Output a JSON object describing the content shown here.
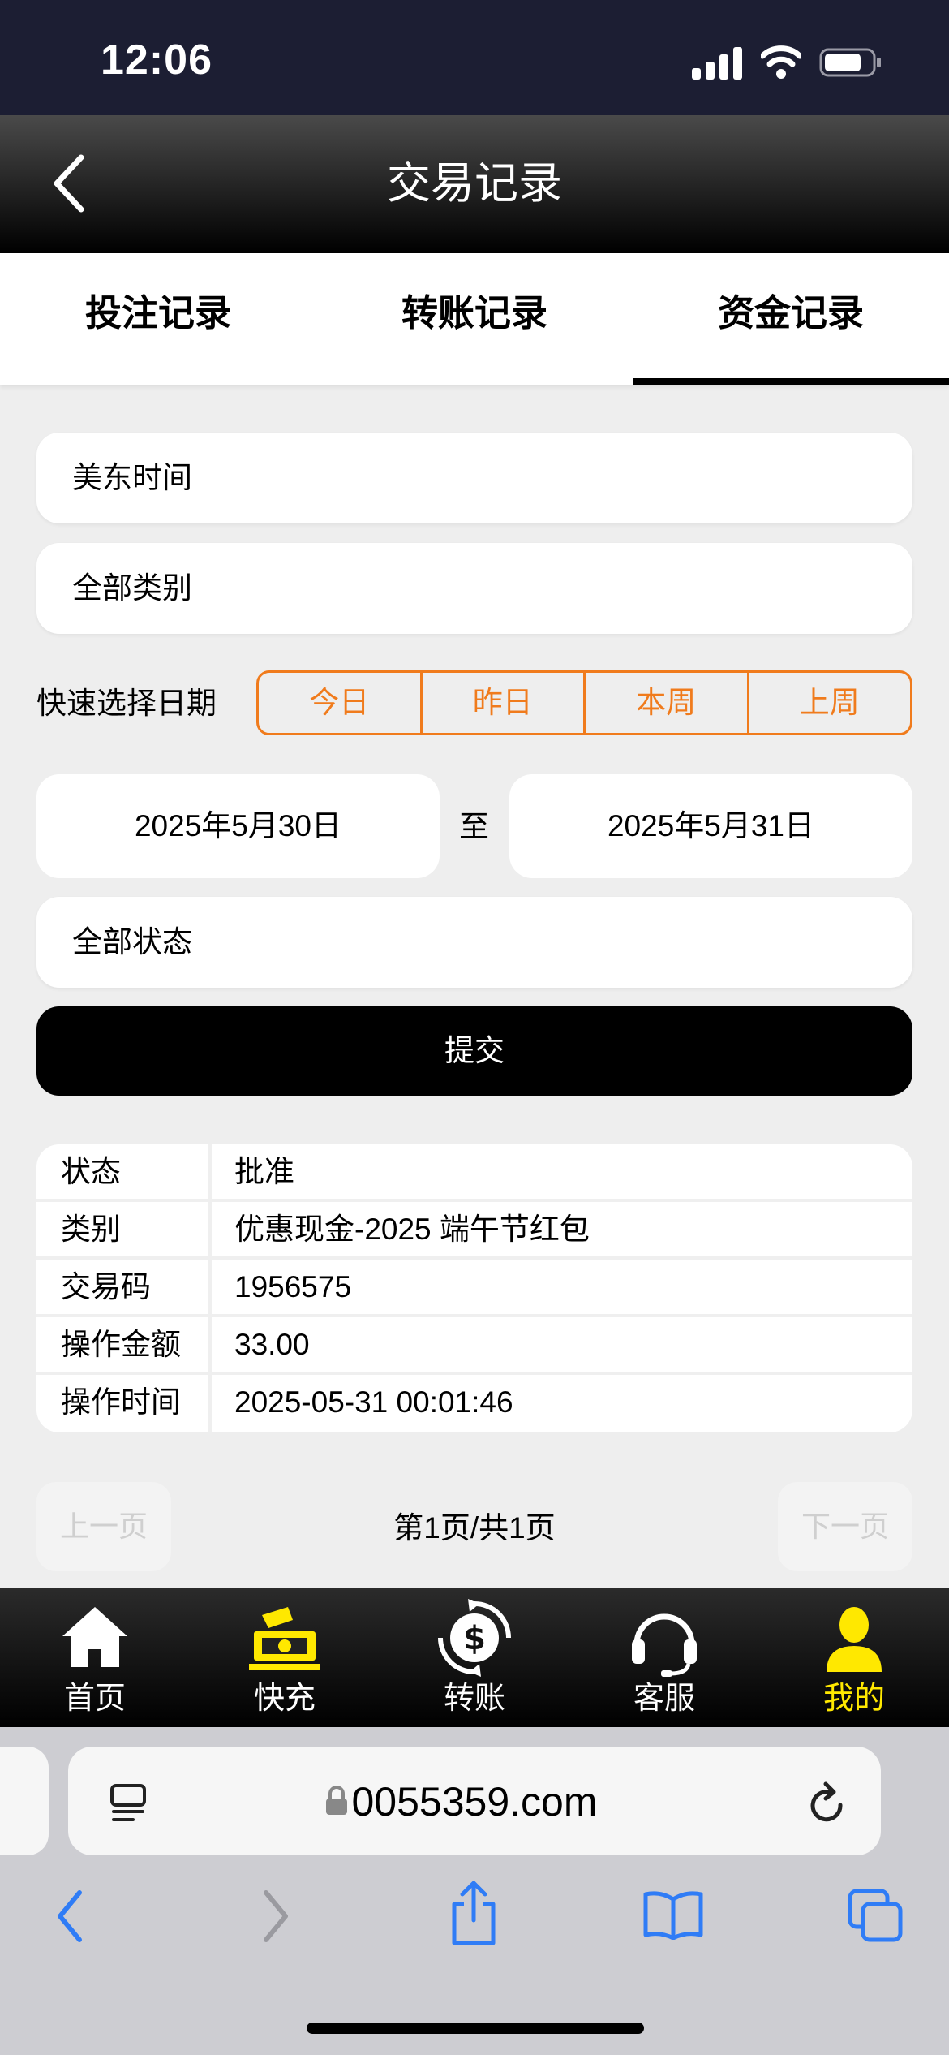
{
  "status_bar": {
    "time": "12:06"
  },
  "header": {
    "title": "交易记录"
  },
  "tabs": [
    {
      "label": "投注记录"
    },
    {
      "label": "转账记录"
    },
    {
      "label": "资金记录",
      "active": true
    }
  ],
  "filters": {
    "timezone": "美东时间",
    "category": "全部类别",
    "quick_label": "快速选择日期",
    "quick_options": [
      "今日",
      "昨日",
      "本周",
      "上周"
    ],
    "date_from": "2025年5月30日",
    "date_to": "2025年5月31日",
    "to_label": "至",
    "status": "全部状态",
    "submit_label": "提交"
  },
  "record": [
    {
      "key": "状态",
      "value": "批准"
    },
    {
      "key": "类别",
      "value": "优惠现金-2025 端午节红包"
    },
    {
      "key": "交易码",
      "value": "1956575"
    },
    {
      "key": "操作金额",
      "value": "33.00"
    },
    {
      "key": "操作时间",
      "value": "2025-05-31 00:01:46"
    }
  ],
  "pager": {
    "prev": "上一页",
    "info": "第1页/共1页",
    "next": "下一页"
  },
  "bottom_nav": [
    {
      "label": "首页",
      "icon": "home-icon"
    },
    {
      "label": "快充",
      "icon": "cash-deposit-icon"
    },
    {
      "label": "转账",
      "icon": "dollar-transfer-icon"
    },
    {
      "label": "客服",
      "icon": "headset-icon"
    },
    {
      "label": "我的",
      "icon": "user-icon",
      "active": true
    }
  ],
  "browser": {
    "url": "0055359.com"
  },
  "colors": {
    "accent": "#f07b1c",
    "active_nav": "#ffe800",
    "status_bar": "#1c1e33",
    "safari_blue": "#2f7cf6"
  }
}
